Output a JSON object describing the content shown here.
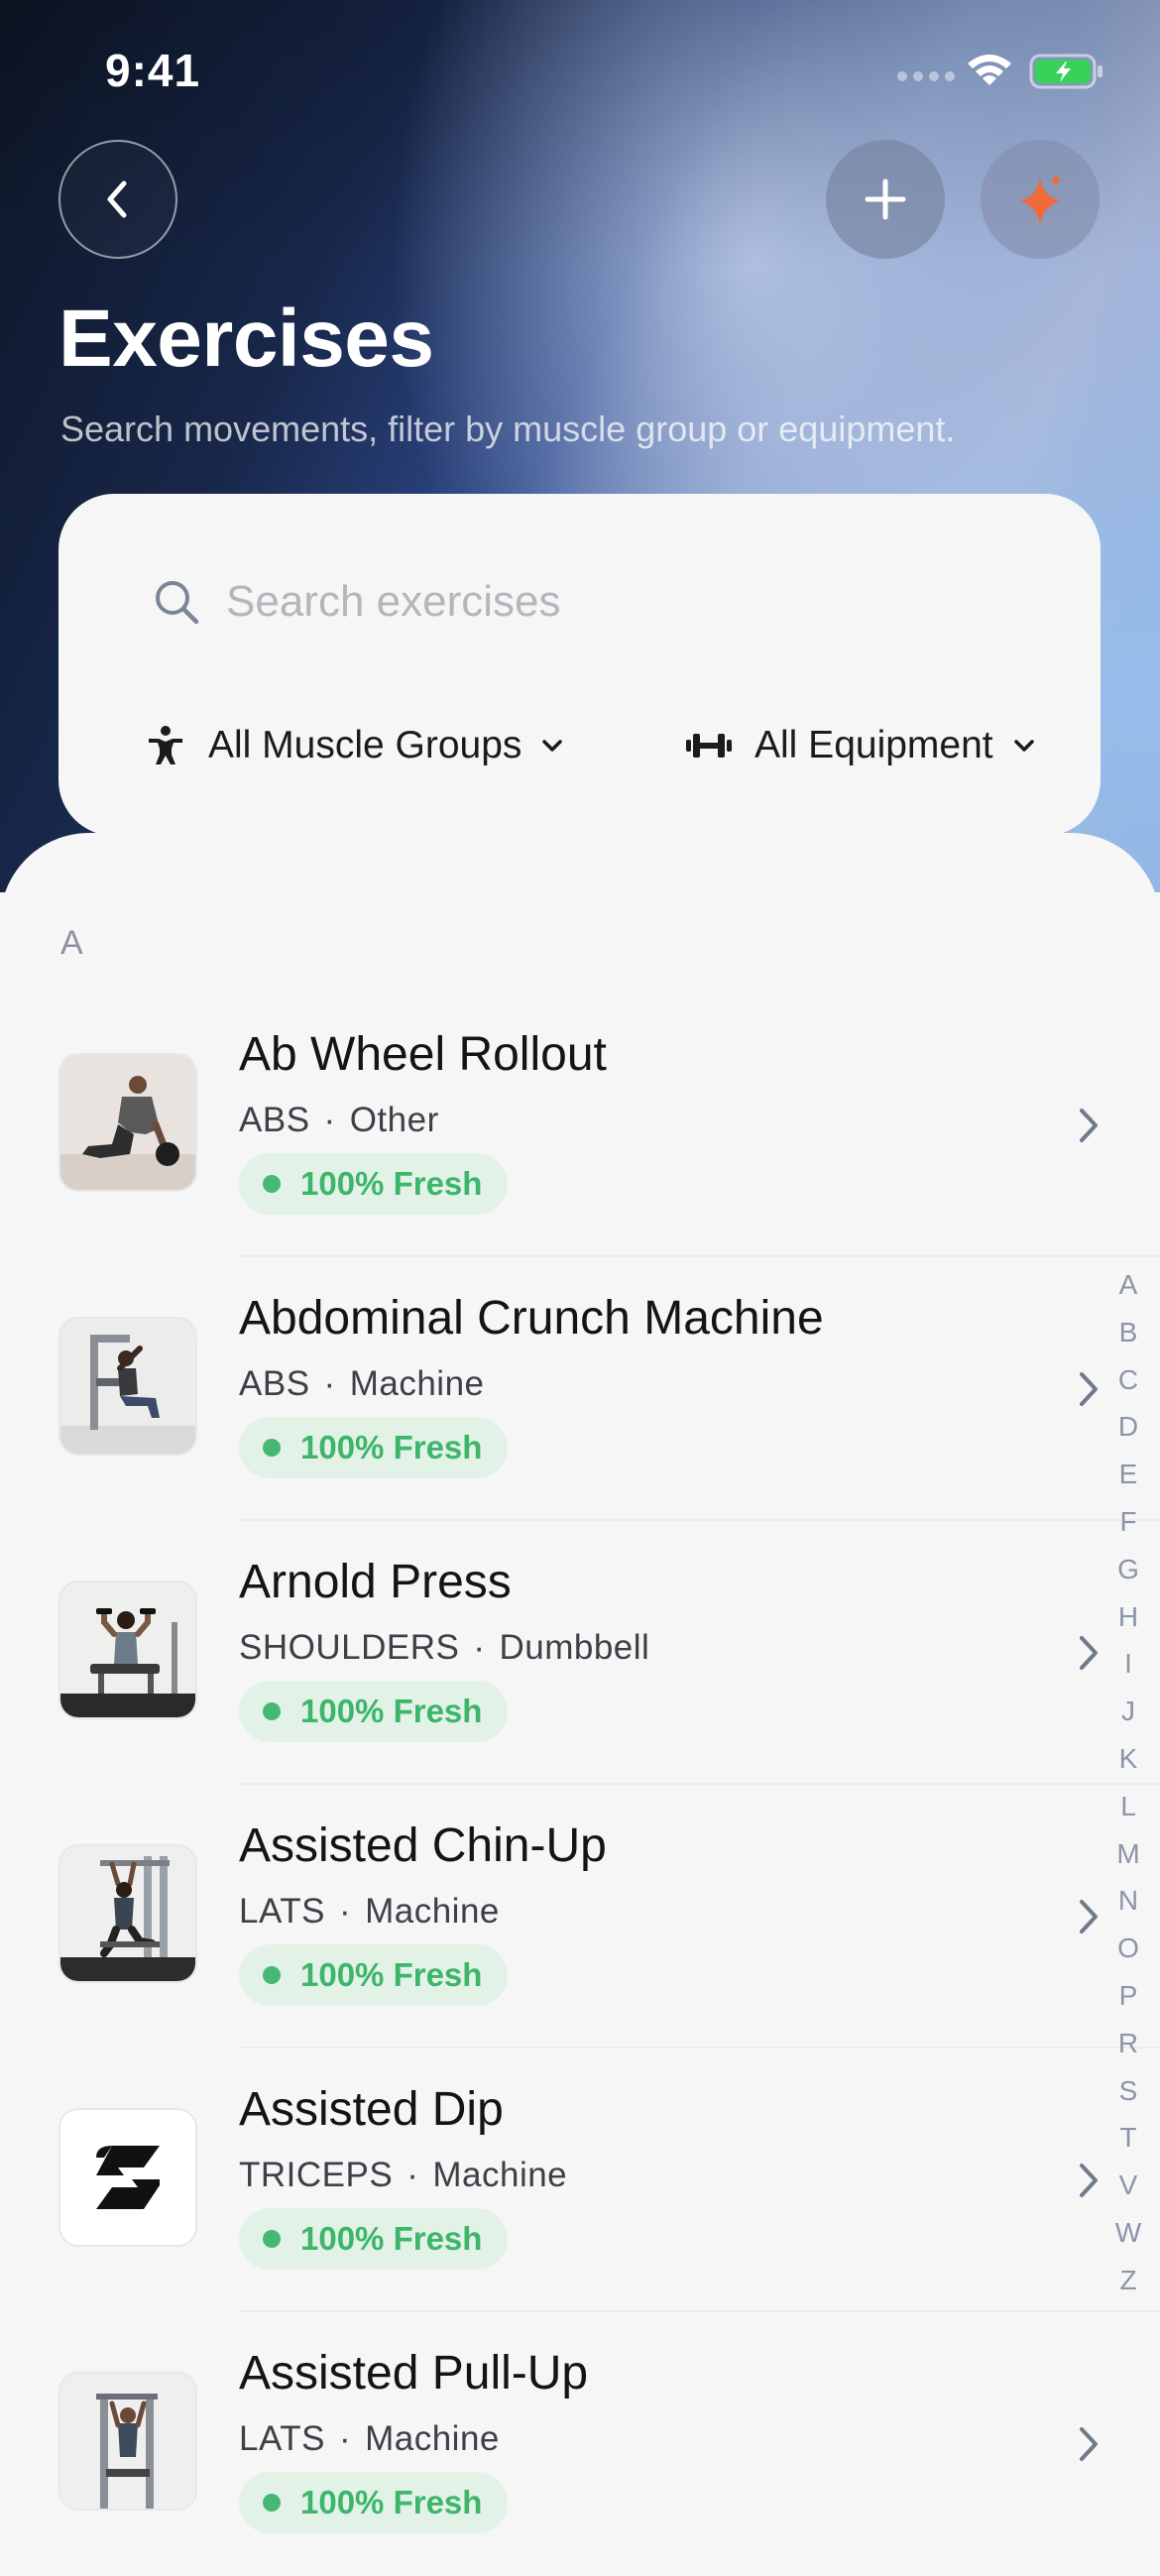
{
  "status_bar": {
    "time": "9:41"
  },
  "header": {
    "title": "Exercises",
    "subtitle": "Search movements, filter by muscle group or equipment.",
    "back_icon": "chevron-left-icon",
    "add_icon": "plus-icon",
    "ai_icon": "sparkle-icon",
    "ai_icon_color": "#f06a3a"
  },
  "search": {
    "placeholder": "Search exercises",
    "value": ""
  },
  "filters": {
    "muscle_groups": "All Muscle Groups",
    "equipment": "All Equipment"
  },
  "list": {
    "section": "A",
    "items": [
      {
        "name": "Ab Wheel Rollout",
        "muscle": "ABS",
        "equipment": "Other",
        "status": "100% Fresh"
      },
      {
        "name": "Abdominal Crunch Machine",
        "muscle": "ABS",
        "equipment": "Machine",
        "status": "100% Fresh"
      },
      {
        "name": "Arnold Press",
        "muscle": "SHOULDERS",
        "equipment": "Dumbbell",
        "status": "100% Fresh"
      },
      {
        "name": "Assisted Chin-Up",
        "muscle": "LATS",
        "equipment": "Machine",
        "status": "100% Fresh"
      },
      {
        "name": "Assisted Dip",
        "muscle": "TRICEPS",
        "equipment": "Machine",
        "status": "100% Fresh"
      },
      {
        "name": "Assisted Pull-Up",
        "muscle": "LATS",
        "equipment": "Machine",
        "status": "100% Fresh"
      }
    ],
    "separator": "·"
  },
  "alphabet_index": [
    "A",
    "B",
    "C",
    "D",
    "E",
    "F",
    "G",
    "H",
    "I",
    "J",
    "K",
    "L",
    "M",
    "N",
    "O",
    "P",
    "R",
    "S",
    "T",
    "V",
    "W",
    "Z"
  ],
  "colors": {
    "fresh_text": "#3db56b",
    "fresh_bg": "#e2f2e7",
    "accent": "#f06a3a"
  }
}
